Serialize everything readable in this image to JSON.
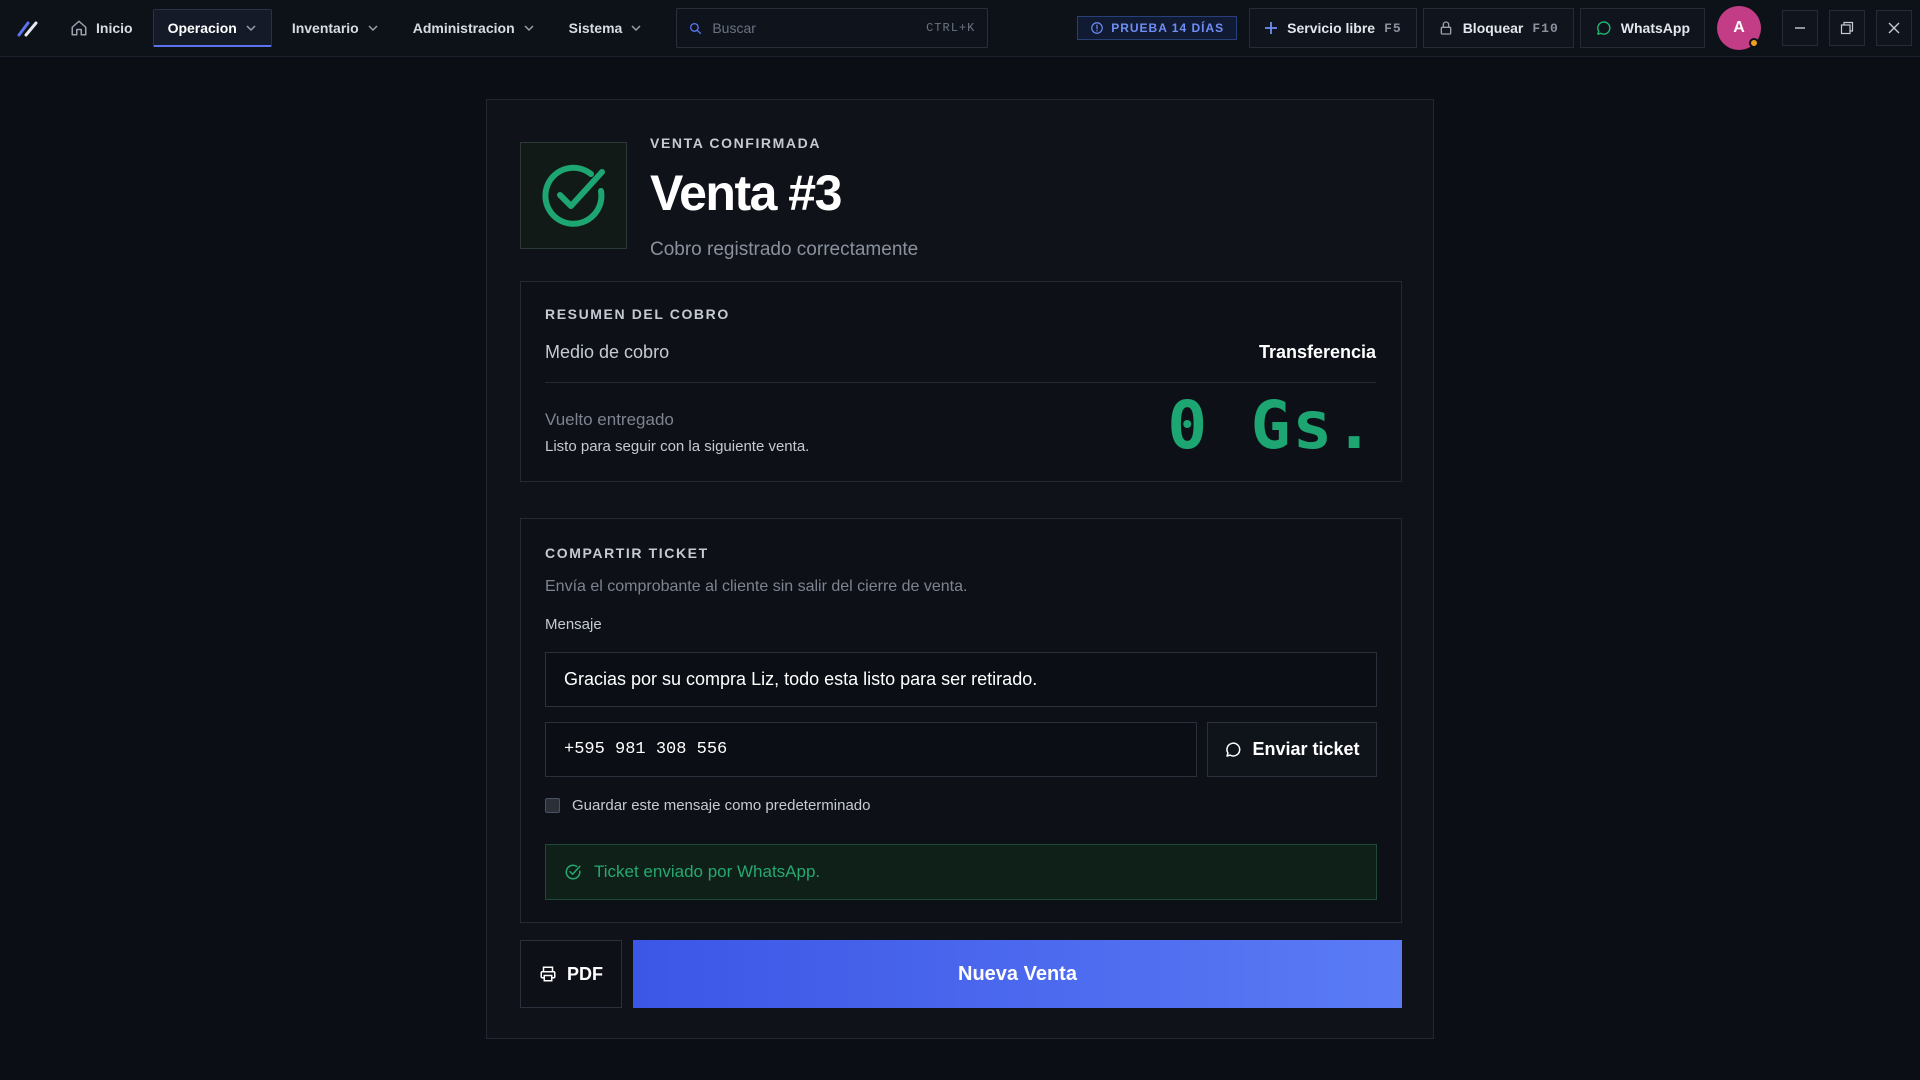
{
  "topbar": {
    "nav": [
      {
        "label": "Inicio"
      },
      {
        "label": "Operacion"
      },
      {
        "label": "Inventario"
      },
      {
        "label": "Administracion"
      },
      {
        "label": "Sistema"
      }
    ],
    "search": {
      "placeholder": "Buscar",
      "shortcut": "CTRL+K"
    },
    "trial": "PRUEBA 14 DÍAS",
    "service": {
      "label": "Servicio libre",
      "shortcut": "F5"
    },
    "lock": {
      "label": "Bloquear",
      "shortcut": "F10"
    },
    "whatsapp": "WhatsApp",
    "avatar": "A"
  },
  "sale": {
    "eyebrow": "VENTA CONFIRMADA",
    "title": "Venta #3",
    "subtitle": "Cobro registrado correctamente"
  },
  "summary": {
    "title": "RESUMEN DEL COBRO",
    "method_label": "Medio de cobro",
    "method_value": "Transferencia",
    "change_label": "Vuelto entregado",
    "change_note": "Listo para seguir con la siguiente venta.",
    "change_amount": "0 Gs."
  },
  "share": {
    "title": "COMPARTIR TICKET",
    "description": "Envía el comprobante al cliente sin salir del cierre de venta.",
    "message_label": "Mensaje",
    "message_value": "Gracias por su compra Liz, todo esta listo para ser retirado.",
    "phone_value": "+595 981 308 556",
    "send_label": "Enviar ticket",
    "save_default_label": "Guardar este mensaje como predeterminado",
    "save_default_checked": false,
    "success_message": "Ticket enviado por WhatsApp."
  },
  "actions": {
    "pdf_label": "PDF",
    "new_sale_label": "Nueva Venta"
  },
  "colors": {
    "accent": "#4a66ee",
    "success": "#1ea672",
    "avatar": "#c23d86"
  }
}
